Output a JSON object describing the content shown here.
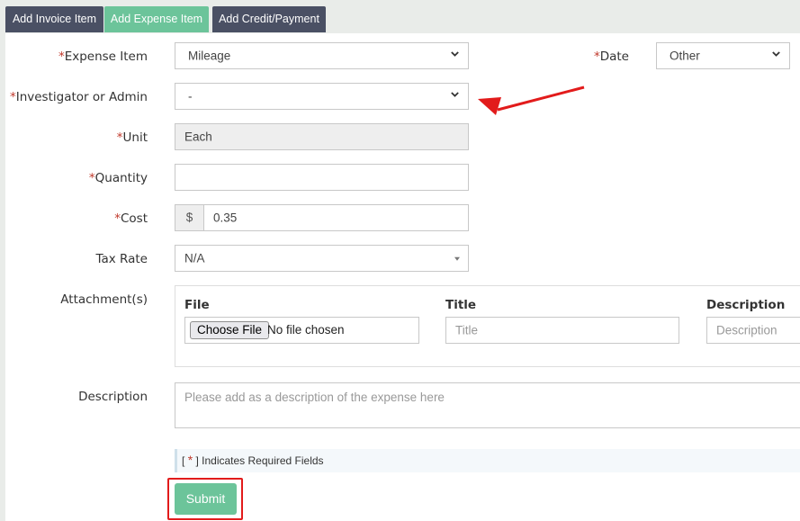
{
  "tabs": {
    "add_invoice_item": "Add Invoice Item",
    "add_expense_item": "Add Expense Item",
    "add_credit_payment": "Add Credit/Payment"
  },
  "form": {
    "required_marker": "*",
    "expense_item": {
      "label": "Expense Item",
      "value": "Mileage"
    },
    "date": {
      "label": "Date",
      "value": "Other"
    },
    "investigator": {
      "label": "Investigator or Admin",
      "value": "-"
    },
    "unit": {
      "label": "Unit",
      "value": "Each"
    },
    "quantity": {
      "label": "Quantity",
      "value": ""
    },
    "cost": {
      "label": "Cost",
      "currency": "$",
      "value": "0.35"
    },
    "tax_rate": {
      "label": "Tax Rate",
      "value": "N/A"
    },
    "attachments": {
      "label": "Attachment(s)",
      "file_header": "File",
      "title_header": "Title",
      "description_header": "Description",
      "choose_file": "Choose File",
      "no_file": "No file chosen",
      "title_placeholder": "Title",
      "description_placeholder": "Description"
    },
    "description": {
      "label": "Description",
      "placeholder": "Please add as a description of the expense here"
    },
    "required_note": {
      "open": "[",
      "star": "*",
      "close": "] Indicates Required Fields"
    },
    "submit": "Submit"
  },
  "colors": {
    "tab_dark": "#4a5064",
    "tab_active": "#6cc49a",
    "required": "#c0392b",
    "highlight": "#e21b1b"
  },
  "icons": {
    "select_chevron": "chevron-down-icon",
    "annotation": "red-arrow-icon"
  }
}
